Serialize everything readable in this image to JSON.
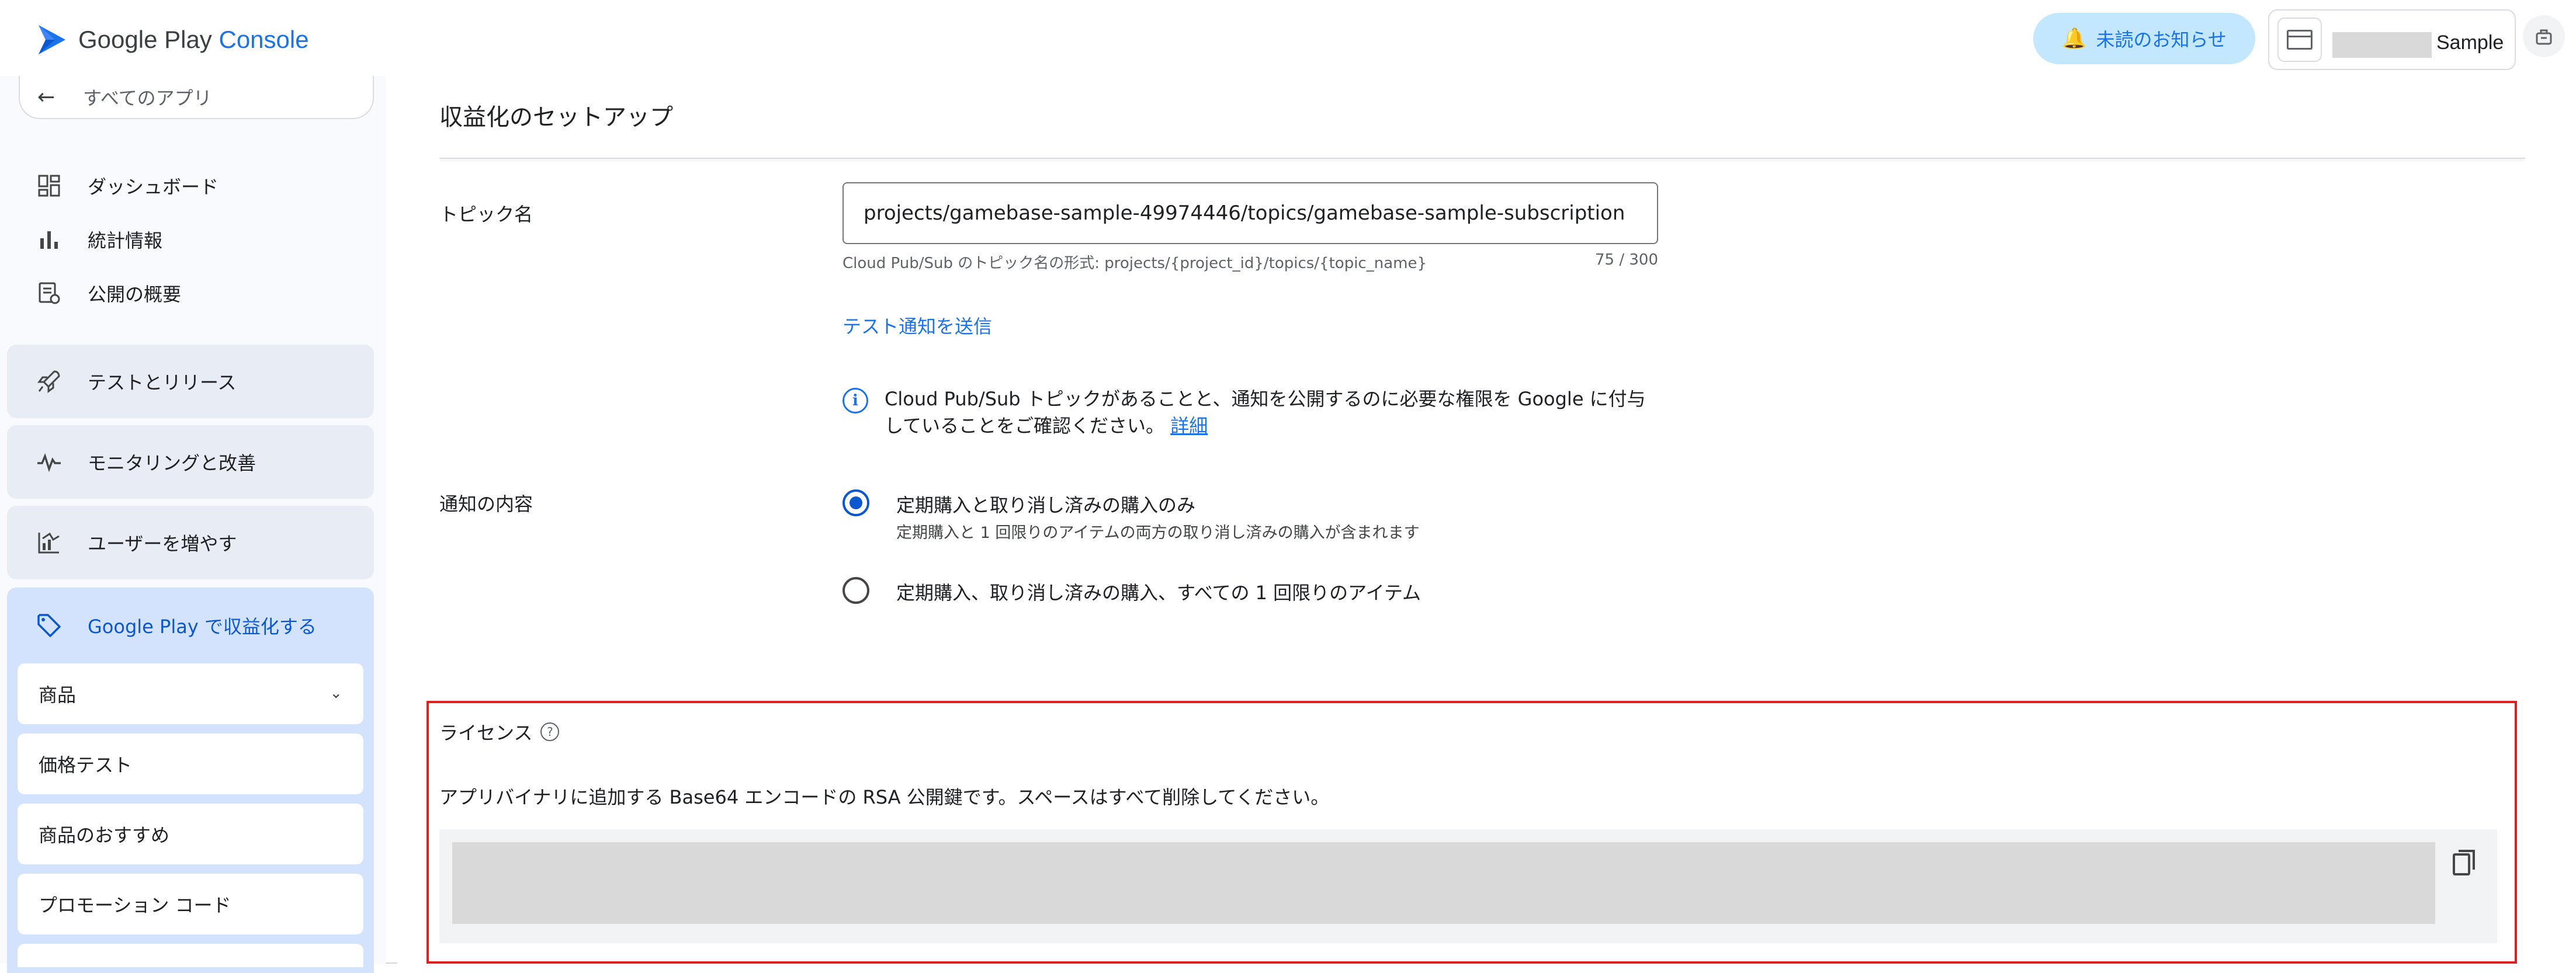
{
  "app": {
    "logo_brand": "Google Play",
    "logo_product": "Console"
  },
  "topbar": {
    "notifications_label": "未読のお知らせ",
    "account_name": "Sample"
  },
  "sidebar": {
    "back_label": "すべてのアプリ",
    "items": [
      {
        "label": "ダッシュボード",
        "icon": "dashboard-icon"
      },
      {
        "label": "統計情報",
        "icon": "bar-chart-icon"
      },
      {
        "label": "公開の概要",
        "icon": "publishing-icon"
      }
    ],
    "groups": [
      {
        "label": "テストとリリース",
        "icon": "rocket-icon"
      },
      {
        "label": "モニタリングと改善",
        "icon": "pulse-icon"
      },
      {
        "label": "ユーザーを増やす",
        "icon": "growth-icon"
      }
    ],
    "active_group": {
      "label": "Google Play で収益化する",
      "icon": "tag-icon",
      "sub_items": [
        {
          "label": "商品",
          "expandable": true
        },
        {
          "label": "価格テスト"
        },
        {
          "label": "商品のおすすめ"
        },
        {
          "label": "プロモーション コード"
        }
      ]
    }
  },
  "main": {
    "section_title": "収益化のセットアップ",
    "topic": {
      "label": "トピック名",
      "value": "projects/gamebase-sample-49974446/topics/gamebase-sample-subscription",
      "helper": "Cloud Pub/Sub のトピック名の形式: projects/{project_id}/topics/{topic_name}",
      "counter": "75 / 300",
      "test_link": "テスト通知を送信",
      "info_text": "Cloud Pub/Sub トピックがあることと、通知を公開するのに必要な権限を Google に付与していることをご確認ください。",
      "info_link": "詳細"
    },
    "notification": {
      "label": "通知の内容",
      "options": [
        {
          "label": "定期購入と取り消し済みの購入のみ",
          "sub": "定期購入と 1 回限りのアイテムの両方の取り消し済みの購入が含まれます",
          "selected": true
        },
        {
          "label": "定期購入、取り消し済みの購入、すべての 1 回限りのアイテム",
          "selected": false
        }
      ]
    },
    "license": {
      "title": "ライセンス",
      "description": "アプリバイナリに追加する Base64 エンコードの RSA 公開鍵です。スペースはすべて削除してください。"
    }
  },
  "colors": {
    "accent": "#1a73e8",
    "active_nav_bg": "#d3e3fd",
    "highlight_border": "#e02020"
  }
}
